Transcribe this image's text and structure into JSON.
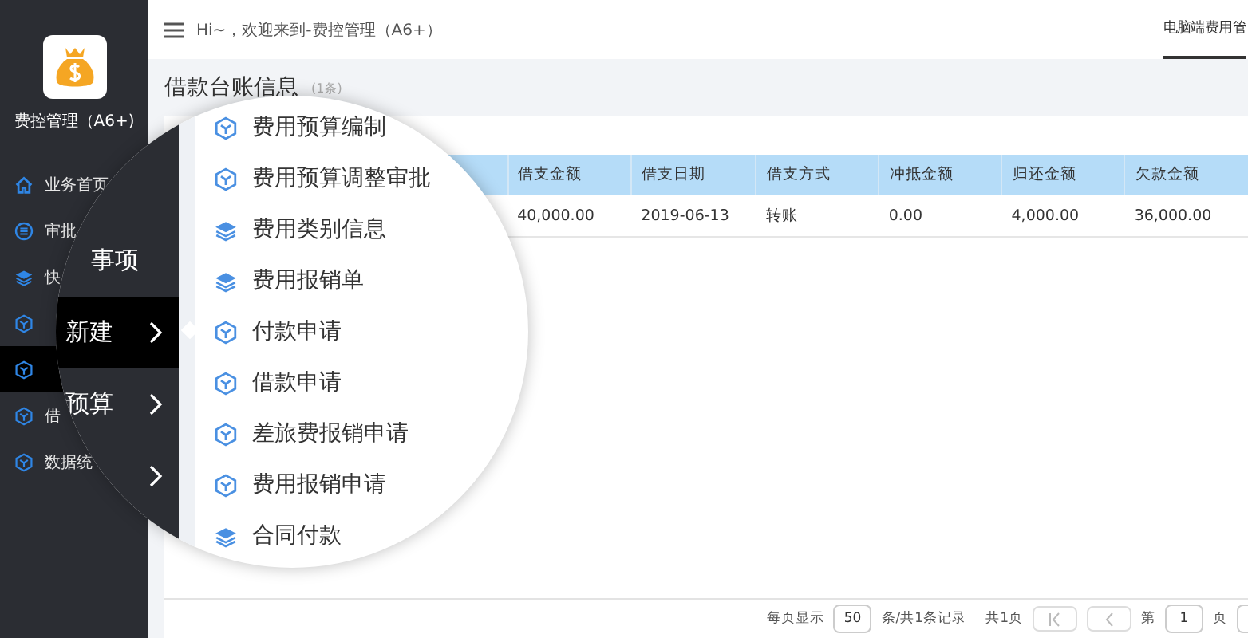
{
  "sidebar": {
    "app_name": "费控管理（A6+)",
    "items": [
      {
        "kind": "home",
        "label": "业务首页",
        "selected": false
      },
      {
        "kind": "list",
        "label": "审批",
        "selected": false
      },
      {
        "kind": "layers",
        "label": "快",
        "selected": false
      },
      {
        "kind": "cube",
        "selected": false
      },
      {
        "kind": "cube",
        "selected": true
      },
      {
        "kind": "cube",
        "label": "借",
        "selected": false
      },
      {
        "kind": "cube",
        "label": "数据统",
        "selected": false
      }
    ]
  },
  "topbar": {
    "greeting": "Hi~，欢迎来到-费控管理（A6+）",
    "tabs": [
      {
        "label": "电脑端费用管",
        "selected": true
      }
    ]
  },
  "page": {
    "title": "借款台账信息",
    "count": "(1条)"
  },
  "table": {
    "columns": [
      "借支金额",
      "借支日期",
      "借支方式",
      "冲抵金额",
      "归还金额",
      "欠款金额"
    ],
    "rows": [
      [
        "40,000.00",
        "2019-06-13",
        "转账",
        "0.00",
        "4,000.00",
        "36,000.00"
      ]
    ]
  },
  "pagination": {
    "per_page_label": "每页显示",
    "per_page": "50",
    "records": "条/共1条记录",
    "pages": "共1页",
    "page_prefix": "第",
    "page": "1",
    "page_suffix": "页"
  },
  "magnifier": {
    "menu": [
      {
        "label": "事项",
        "selected": false,
        "expandable": false
      },
      {
        "label": "新建",
        "selected": true,
        "expandable": true
      },
      {
        "label": "预算",
        "selected": false,
        "expandable": true
      },
      {
        "selected": false,
        "expandable": true
      }
    ],
    "submenu": [
      {
        "kind": "cube",
        "label": "费用预算编制"
      },
      {
        "kind": "cube",
        "label": "费用预算调整审批"
      },
      {
        "kind": "layers",
        "label": "费用类别信息"
      },
      {
        "kind": "layers",
        "label": "费用报销单"
      },
      {
        "kind": "cube",
        "label": "付款申请"
      },
      {
        "kind": "cube",
        "label": "借款申请"
      },
      {
        "kind": "cube",
        "label": "差旅费报销申请"
      },
      {
        "kind": "cube",
        "label": "费用报销申请"
      },
      {
        "kind": "layers",
        "label": "合同付款"
      }
    ]
  }
}
